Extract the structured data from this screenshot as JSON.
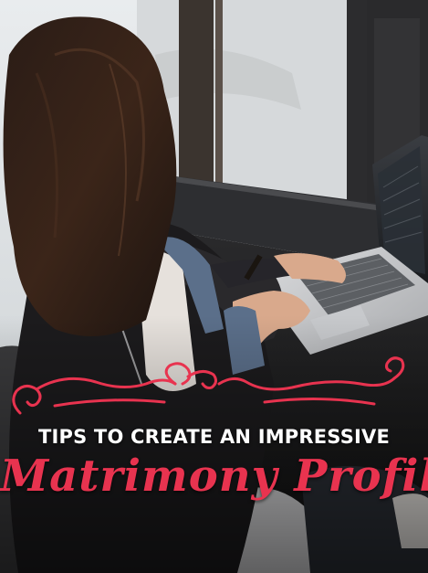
{
  "headline": "TIPS TO CREATE AN IMPRESSIVE",
  "script_title": "Matrimony Profile",
  "colors": {
    "accent": "#e8334f",
    "headline": "#ffffff"
  },
  "decorations": [
    "swirl-ornament"
  ]
}
